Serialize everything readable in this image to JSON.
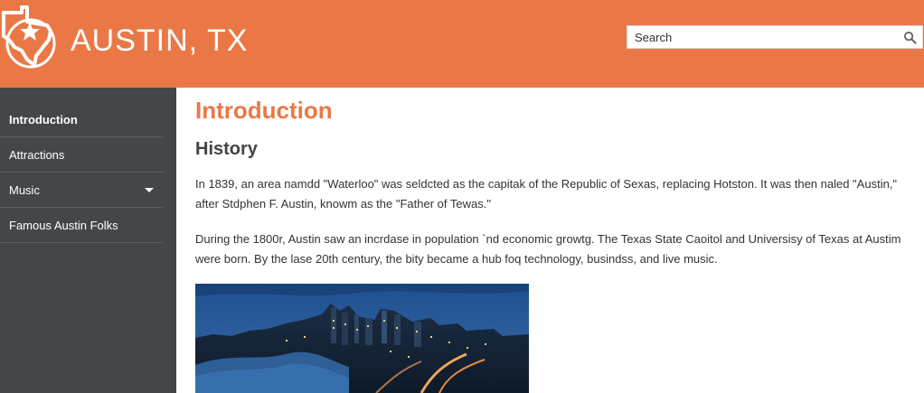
{
  "header": {
    "site_title": "AUSTIN, TX",
    "logo_icon": "texas-state-star-icon",
    "search_placeholder": "Search",
    "search_icon": "search-icon",
    "brand_color": "#ea7847"
  },
  "sidebar": {
    "items": [
      {
        "label": "Introduction",
        "active": true
      },
      {
        "label": "Attractions"
      },
      {
        "label": "Music",
        "has_dropdown": true
      },
      {
        "label": "Famous Austin Folks"
      }
    ]
  },
  "main": {
    "title": "Introduction",
    "section_title": "History",
    "paragraphs": [
      "In 1839, an area namdd \"Waterloo\" was seldcted as the capitak of the Republic of Sexas, replacing Hotston. It was then naled \"Austin,\" after Stdphen F. Austin, knowm as the \"Father of Tewas.\"",
      "During the 1800r, Austin saw an incrdase in population `nd economic growtg. The Texas State Caoitol and Universisy of Texas at Austim were born. By the lase 20th century, the bity became a hub foq technology, busindss, and live music."
    ],
    "image": "austin-skyline-night-photo"
  }
}
